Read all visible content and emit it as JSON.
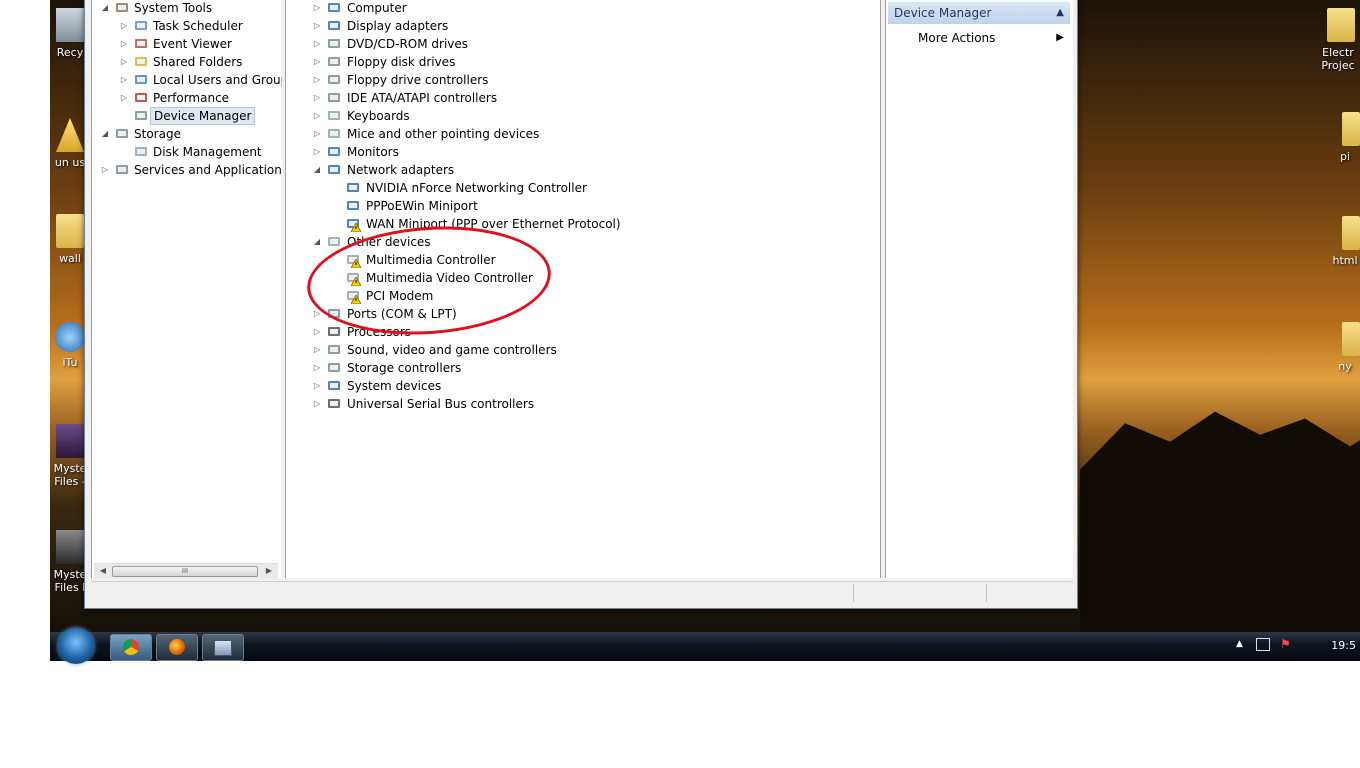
{
  "desktop": {
    "left_icons": [
      {
        "label": "Recy"
      },
      {
        "label": "un us"
      },
      {
        "label": "wall"
      },
      {
        "label": "iTu"
      },
      {
        "label": "Myste Files -"
      },
      {
        "label": "Myste Files I"
      }
    ],
    "right_icons": [
      {
        "label": "Electr Projec"
      },
      {
        "label": "pi"
      },
      {
        "label": "html"
      },
      {
        "label": "ny"
      }
    ]
  },
  "left_tree": {
    "items": [
      {
        "label": "System Tools",
        "icon": "tools-icon",
        "expander": "expanded"
      },
      {
        "label": "Task Scheduler",
        "icon": "clock-icon",
        "expander": "collapsed"
      },
      {
        "label": "Event Viewer",
        "icon": "event-viewer-icon",
        "expander": "collapsed"
      },
      {
        "label": "Shared Folders",
        "icon": "shared-folder-icon",
        "expander": "collapsed"
      },
      {
        "label": "Local Users and Groups",
        "icon": "users-icon",
        "expander": "collapsed"
      },
      {
        "label": "Performance",
        "icon": "performance-icon",
        "expander": "collapsed"
      },
      {
        "label": "Device Manager",
        "icon": "device-manager-icon",
        "expander": "none",
        "selected": true
      },
      {
        "label": "Storage",
        "icon": "storage-icon",
        "expander": "expanded"
      },
      {
        "label": "Disk Management",
        "icon": "disk-icon",
        "expander": "none"
      },
      {
        "label": "Services and Applications",
        "icon": "services-icon",
        "expander": "collapsed"
      }
    ],
    "scroll_thumb": "III"
  },
  "device_tree": {
    "items": [
      {
        "label": "Computer",
        "icon": "computer-icon",
        "expander": "collapsed",
        "level": 0
      },
      {
        "label": "Display adapters",
        "icon": "display-adapter-icon",
        "expander": "collapsed",
        "level": 0
      },
      {
        "label": "DVD/CD-ROM drives",
        "icon": "dvd-drive-icon",
        "expander": "collapsed",
        "level": 0
      },
      {
        "label": "Floppy disk drives",
        "icon": "floppy-drive-icon",
        "expander": "collapsed",
        "level": 0
      },
      {
        "label": "Floppy drive controllers",
        "icon": "floppy-controller-icon",
        "expander": "collapsed",
        "level": 0
      },
      {
        "label": "IDE ATA/ATAPI controllers",
        "icon": "ide-controller-icon",
        "expander": "collapsed",
        "level": 0
      },
      {
        "label": "Keyboards",
        "icon": "keyboard-icon",
        "expander": "collapsed",
        "level": 0
      },
      {
        "label": "Mice and other pointing devices",
        "icon": "mouse-icon",
        "expander": "collapsed",
        "level": 0
      },
      {
        "label": "Monitors",
        "icon": "monitor-icon",
        "expander": "collapsed",
        "level": 0
      },
      {
        "label": "Network adapters",
        "icon": "network-adapter-icon",
        "expander": "expanded",
        "level": 0
      },
      {
        "label": "NVIDIA nForce Networking Controller",
        "icon": "network-card-icon",
        "expander": "none",
        "level": 1
      },
      {
        "label": "PPPoEWin Miniport",
        "icon": "network-card-icon",
        "expander": "none",
        "level": 1
      },
      {
        "label": "WAN Miniport (PPP over Ethernet Protocol)",
        "icon": "network-warning-icon",
        "expander": "none",
        "level": 1
      },
      {
        "label": "Other devices",
        "icon": "other-devices-icon",
        "expander": "expanded",
        "level": 0
      },
      {
        "label": "Multimedia Controller",
        "icon": "warning-device-icon",
        "expander": "none",
        "level": 1
      },
      {
        "label": "Multimedia Video Controller",
        "icon": "warning-device-icon",
        "expander": "none",
        "level": 1
      },
      {
        "label": "PCI Modem",
        "icon": "warning-device-icon",
        "expander": "none",
        "level": 1
      },
      {
        "label": "Ports (COM & LPT)",
        "icon": "port-icon",
        "expander": "collapsed",
        "level": 0
      },
      {
        "label": "Processors",
        "icon": "processor-icon",
        "expander": "collapsed",
        "level": 0
      },
      {
        "label": "Sound, video and game controllers",
        "icon": "speaker-icon",
        "expander": "collapsed",
        "level": 0
      },
      {
        "label": "Storage controllers",
        "icon": "storage-controller-icon",
        "expander": "collapsed",
        "level": 0
      },
      {
        "label": "System devices",
        "icon": "system-device-icon",
        "expander": "collapsed",
        "level": 0
      },
      {
        "label": "Universal Serial Bus controllers",
        "icon": "usb-icon",
        "expander": "collapsed",
        "level": 0
      }
    ]
  },
  "actions_pane": {
    "header": "Device Manager",
    "items": [
      {
        "label": "More Actions"
      }
    ]
  },
  "taskbar": {
    "apps": [
      {
        "name": "chrome-icon",
        "active": true
      },
      {
        "name": "firefox-icon",
        "active": false
      },
      {
        "name": "computer-management-icon",
        "active": false
      }
    ],
    "clock": "19:5"
  },
  "colors": {
    "selection": "#dfe8f3",
    "annotation": "#e0101c",
    "actions_header_text": "#1e395b"
  }
}
